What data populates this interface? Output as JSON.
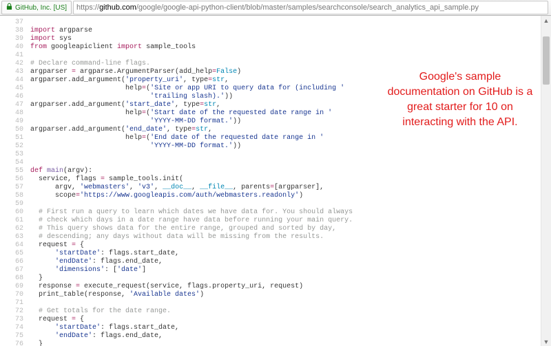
{
  "browser": {
    "identity_label": "GitHub, Inc. [US]",
    "url_scheme": "https://",
    "url_host": "github.com",
    "url_path": "/google/google-api-python-client/blob/master/samples/searchconsole/search_analytics_api_sample.py"
  },
  "annotation": "Google's sample documentation on GitHub is a great starter for 10 on interacting with the API.",
  "code": {
    "lines": [
      {
        "n": "37",
        "cls": "",
        "t": ""
      },
      {
        "n": "38",
        "cls": "",
        "t": "<span class='kw'>import</span> argparse"
      },
      {
        "n": "39",
        "cls": "",
        "t": "<span class='kw'>import</span> sys"
      },
      {
        "n": "40",
        "cls": "",
        "t": "<span class='kw'>from</span> googleapiclient <span class='kw'>import</span> sample_tools"
      },
      {
        "n": "41",
        "cls": "",
        "t": ""
      },
      {
        "n": "42",
        "cls": "",
        "t": "<span class='cm'># Declare command-line flags.</span>"
      },
      {
        "n": "43",
        "cls": "",
        "t": "argparser <span class='op'>=</span> argparse.ArgumentParser(<span class='va'>add_help</span><span class='op'>=</span><span class='nm'>False</span>)"
      },
      {
        "n": "44",
        "cls": "",
        "t": "argparser.add_argument(<span class='st'>'property_uri'</span>, <span class='va'>type</span><span class='op'>=</span><span class='nm'>str</span>,"
      },
      {
        "n": "45",
        "cls": "",
        "t": "                       <span class='va'>help</span><span class='op'>=</span>(<span class='st'>'Site or app URI to query data for (including '</span>"
      },
      {
        "n": "46",
        "cls": "",
        "t": "                             <span class='st'>'trailing slash).'</span>))"
      },
      {
        "n": "47",
        "cls": "",
        "t": "argparser.add_argument(<span class='st'>'start_date'</span>, <span class='va'>type</span><span class='op'>=</span><span class='nm'>str</span>,"
      },
      {
        "n": "48",
        "cls": "",
        "t": "                       <span class='va'>help</span><span class='op'>=</span>(<span class='st'>'Start date of the requested date range in '</span>"
      },
      {
        "n": "49",
        "cls": "",
        "t": "                             <span class='st'>'YYYY-MM-DD format.'</span>))"
      },
      {
        "n": "50",
        "cls": "",
        "t": "argparser.add_argument(<span class='st'>'end_date'</span>, <span class='va'>type</span><span class='op'>=</span><span class='nm'>str</span>,"
      },
      {
        "n": "51",
        "cls": "",
        "t": "                       <span class='va'>help</span><span class='op'>=</span>(<span class='st'>'End date of the requested date range in '</span>"
      },
      {
        "n": "52",
        "cls": "",
        "t": "                             <span class='st'>'YYYY-MM-DD format.'</span>))"
      },
      {
        "n": "53",
        "cls": "",
        "t": ""
      },
      {
        "n": "54",
        "cls": "",
        "t": ""
      },
      {
        "n": "55",
        "cls": "",
        "t": "<span class='kw'>def</span> <span class='fn'>main</span>(<span class='va'>argv</span>):"
      },
      {
        "n": "56",
        "cls": "",
        "t": "  service, flags <span class='op'>=</span> sample_tools.init("
      },
      {
        "n": "57",
        "cls": "",
        "t": "      argv, <span class='st'>'webmasters'</span>, <span class='st'>'v3'</span>, <span class='nm'>__doc__</span>, <span class='nm'>__file__</span>, <span class='va'>parents</span><span class='op'>=</span>[argparser],"
      },
      {
        "n": "58",
        "cls": "",
        "t": "      <span class='va'>scope</span><span class='op'>=</span><span class='st'>'https://www.googleapis.com/auth/webmasters.readonly'</span>)"
      },
      {
        "n": "59",
        "cls": "",
        "t": ""
      },
      {
        "n": "60",
        "cls": "",
        "t": "  <span class='cm'># First run a query to learn which dates we have data for. You should always</span>"
      },
      {
        "n": "61",
        "cls": "",
        "t": "  <span class='cm'># check which days in a date range have data before running your main query.</span>"
      },
      {
        "n": "62",
        "cls": "",
        "t": "  <span class='cm'># This query shows data for the entire range, grouped and sorted by day,</span>"
      },
      {
        "n": "63",
        "cls": "",
        "t": "  <span class='cm'># descending; any days without data will be missing from the results.</span>"
      },
      {
        "n": "64",
        "cls": "",
        "t": "  request <span class='op'>=</span> {"
      },
      {
        "n": "65",
        "cls": "",
        "t": "      <span class='st'>'startDate'</span>: flags.start_date,"
      },
      {
        "n": "66",
        "cls": "",
        "t": "      <span class='st'>'endDate'</span>: flags.end_date,"
      },
      {
        "n": "67",
        "cls": "",
        "t": "      <span class='st'>'dimensions'</span>: [<span class='st'>'date'</span>]"
      },
      {
        "n": "68",
        "cls": "",
        "t": "  }"
      },
      {
        "n": "69",
        "cls": "",
        "t": "  response <span class='op'>=</span> execute_request(service, flags.property_uri, request)"
      },
      {
        "n": "70",
        "cls": "",
        "t": "  print_table(response, <span class='st'>'Available dates'</span>)"
      },
      {
        "n": "71",
        "cls": "",
        "t": ""
      },
      {
        "n": "72",
        "cls": "",
        "t": "  <span class='cm'># Get totals for the date range.</span>"
      },
      {
        "n": "73",
        "cls": "",
        "t": "  request <span class='op'>=</span> {"
      },
      {
        "n": "74",
        "cls": "",
        "t": "      <span class='st'>'startDate'</span>: flags.start_date,"
      },
      {
        "n": "75",
        "cls": "",
        "t": "      <span class='st'>'endDate'</span>: flags.end_date,"
      },
      {
        "n": "76",
        "cls": "",
        "t": "  }"
      }
    ]
  }
}
